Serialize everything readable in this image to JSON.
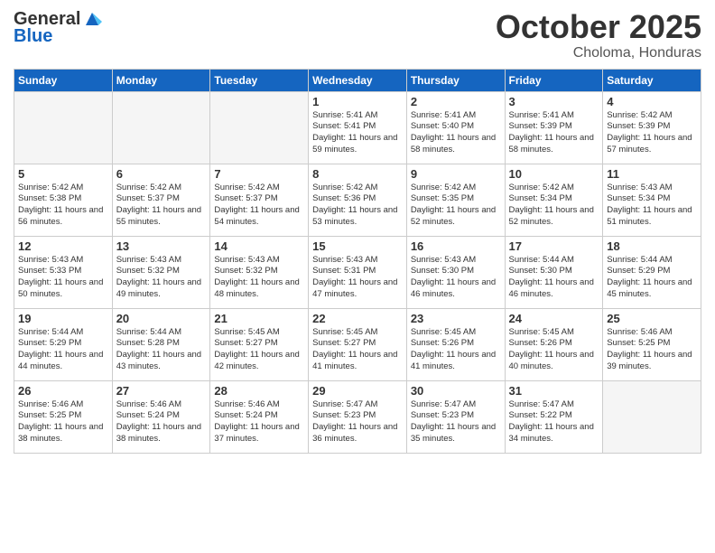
{
  "header": {
    "logo_general": "General",
    "logo_blue": "Blue",
    "month_title": "October 2025",
    "subtitle": "Choloma, Honduras"
  },
  "weekdays": [
    "Sunday",
    "Monday",
    "Tuesday",
    "Wednesday",
    "Thursday",
    "Friday",
    "Saturday"
  ],
  "weeks": [
    [
      {
        "day": "",
        "empty": true
      },
      {
        "day": "",
        "empty": true
      },
      {
        "day": "",
        "empty": true
      },
      {
        "day": "1",
        "sunrise": "Sunrise: 5:41 AM",
        "sunset": "Sunset: 5:41 PM",
        "daylight": "Daylight: 11 hours and 59 minutes."
      },
      {
        "day": "2",
        "sunrise": "Sunrise: 5:41 AM",
        "sunset": "Sunset: 5:40 PM",
        "daylight": "Daylight: 11 hours and 58 minutes."
      },
      {
        "day": "3",
        "sunrise": "Sunrise: 5:41 AM",
        "sunset": "Sunset: 5:39 PM",
        "daylight": "Daylight: 11 hours and 58 minutes."
      },
      {
        "day": "4",
        "sunrise": "Sunrise: 5:42 AM",
        "sunset": "Sunset: 5:39 PM",
        "daylight": "Daylight: 11 hours and 57 minutes."
      }
    ],
    [
      {
        "day": "5",
        "sunrise": "Sunrise: 5:42 AM",
        "sunset": "Sunset: 5:38 PM",
        "daylight": "Daylight: 11 hours and 56 minutes."
      },
      {
        "day": "6",
        "sunrise": "Sunrise: 5:42 AM",
        "sunset": "Sunset: 5:37 PM",
        "daylight": "Daylight: 11 hours and 55 minutes."
      },
      {
        "day": "7",
        "sunrise": "Sunrise: 5:42 AM",
        "sunset": "Sunset: 5:37 PM",
        "daylight": "Daylight: 11 hours and 54 minutes."
      },
      {
        "day": "8",
        "sunrise": "Sunrise: 5:42 AM",
        "sunset": "Sunset: 5:36 PM",
        "daylight": "Daylight: 11 hours and 53 minutes."
      },
      {
        "day": "9",
        "sunrise": "Sunrise: 5:42 AM",
        "sunset": "Sunset: 5:35 PM",
        "daylight": "Daylight: 11 hours and 52 minutes."
      },
      {
        "day": "10",
        "sunrise": "Sunrise: 5:42 AM",
        "sunset": "Sunset: 5:34 PM",
        "daylight": "Daylight: 11 hours and 52 minutes."
      },
      {
        "day": "11",
        "sunrise": "Sunrise: 5:43 AM",
        "sunset": "Sunset: 5:34 PM",
        "daylight": "Daylight: 11 hours and 51 minutes."
      }
    ],
    [
      {
        "day": "12",
        "sunrise": "Sunrise: 5:43 AM",
        "sunset": "Sunset: 5:33 PM",
        "daylight": "Daylight: 11 hours and 50 minutes."
      },
      {
        "day": "13",
        "sunrise": "Sunrise: 5:43 AM",
        "sunset": "Sunset: 5:32 PM",
        "daylight": "Daylight: 11 hours and 49 minutes."
      },
      {
        "day": "14",
        "sunrise": "Sunrise: 5:43 AM",
        "sunset": "Sunset: 5:32 PM",
        "daylight": "Daylight: 11 hours and 48 minutes."
      },
      {
        "day": "15",
        "sunrise": "Sunrise: 5:43 AM",
        "sunset": "Sunset: 5:31 PM",
        "daylight": "Daylight: 11 hours and 47 minutes."
      },
      {
        "day": "16",
        "sunrise": "Sunrise: 5:43 AM",
        "sunset": "Sunset: 5:30 PM",
        "daylight": "Daylight: 11 hours and 46 minutes."
      },
      {
        "day": "17",
        "sunrise": "Sunrise: 5:44 AM",
        "sunset": "Sunset: 5:30 PM",
        "daylight": "Daylight: 11 hours and 46 minutes."
      },
      {
        "day": "18",
        "sunrise": "Sunrise: 5:44 AM",
        "sunset": "Sunset: 5:29 PM",
        "daylight": "Daylight: 11 hours and 45 minutes."
      }
    ],
    [
      {
        "day": "19",
        "sunrise": "Sunrise: 5:44 AM",
        "sunset": "Sunset: 5:29 PM",
        "daylight": "Daylight: 11 hours and 44 minutes."
      },
      {
        "day": "20",
        "sunrise": "Sunrise: 5:44 AM",
        "sunset": "Sunset: 5:28 PM",
        "daylight": "Daylight: 11 hours and 43 minutes."
      },
      {
        "day": "21",
        "sunrise": "Sunrise: 5:45 AM",
        "sunset": "Sunset: 5:27 PM",
        "daylight": "Daylight: 11 hours and 42 minutes."
      },
      {
        "day": "22",
        "sunrise": "Sunrise: 5:45 AM",
        "sunset": "Sunset: 5:27 PM",
        "daylight": "Daylight: 11 hours and 41 minutes."
      },
      {
        "day": "23",
        "sunrise": "Sunrise: 5:45 AM",
        "sunset": "Sunset: 5:26 PM",
        "daylight": "Daylight: 11 hours and 41 minutes."
      },
      {
        "day": "24",
        "sunrise": "Sunrise: 5:45 AM",
        "sunset": "Sunset: 5:26 PM",
        "daylight": "Daylight: 11 hours and 40 minutes."
      },
      {
        "day": "25",
        "sunrise": "Sunrise: 5:46 AM",
        "sunset": "Sunset: 5:25 PM",
        "daylight": "Daylight: 11 hours and 39 minutes."
      }
    ],
    [
      {
        "day": "26",
        "sunrise": "Sunrise: 5:46 AM",
        "sunset": "Sunset: 5:25 PM",
        "daylight": "Daylight: 11 hours and 38 minutes."
      },
      {
        "day": "27",
        "sunrise": "Sunrise: 5:46 AM",
        "sunset": "Sunset: 5:24 PM",
        "daylight": "Daylight: 11 hours and 38 minutes."
      },
      {
        "day": "28",
        "sunrise": "Sunrise: 5:46 AM",
        "sunset": "Sunset: 5:24 PM",
        "daylight": "Daylight: 11 hours and 37 minutes."
      },
      {
        "day": "29",
        "sunrise": "Sunrise: 5:47 AM",
        "sunset": "Sunset: 5:23 PM",
        "daylight": "Daylight: 11 hours and 36 minutes."
      },
      {
        "day": "30",
        "sunrise": "Sunrise: 5:47 AM",
        "sunset": "Sunset: 5:23 PM",
        "daylight": "Daylight: 11 hours and 35 minutes."
      },
      {
        "day": "31",
        "sunrise": "Sunrise: 5:47 AM",
        "sunset": "Sunset: 5:22 PM",
        "daylight": "Daylight: 11 hours and 34 minutes."
      },
      {
        "day": "",
        "empty": true
      }
    ]
  ]
}
